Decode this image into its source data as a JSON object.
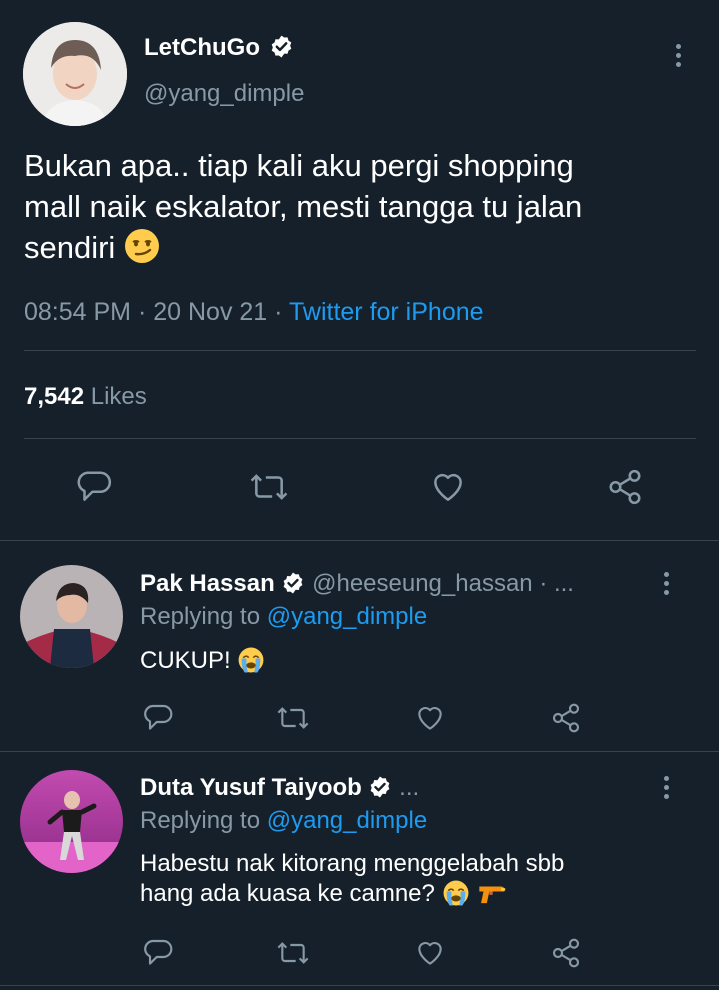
{
  "main_tweet": {
    "author_name": "LetChuGo",
    "handle": "@yang_dimple",
    "text_lines": [
      "Bukan apa.. tiap kali aku pergi shopping",
      "mall naik eskalator, mesti tangga tu jalan",
      "sendiri"
    ],
    "emoji": "smirk-emoji",
    "time": "08:54 PM",
    "sep1": "·",
    "date": "20 Nov 21",
    "sep2": "·",
    "source": "Twitter for iPhone",
    "likes_count": "7,542",
    "likes_label": "Likes"
  },
  "replies": [
    {
      "author_name": "Pak Hassan",
      "handle": "@heeseung_hassan · ...",
      "replying_prefix": "Replying to",
      "replying_handle": "@yang_dimple",
      "text": "CUKUP!",
      "emoji": "crying-face-emoji"
    },
    {
      "author_name": "Duta Yusuf Taiyoob",
      "handle": "...",
      "replying_prefix": "Replying to",
      "replying_handle": "@yang_dimple",
      "text_lines": [
        "Habestu nak kitorang menggelabah sbb",
        "hang ada kuasa ke camne?"
      ],
      "emoji": "crying-face-emoji",
      "emoji2": "water-pistol-emoji"
    }
  ],
  "colors": {
    "background": "#15202b",
    "text": "#ffffff",
    "muted": "#8899a6",
    "link": "#1d9bf0",
    "divider": "#38444d"
  }
}
